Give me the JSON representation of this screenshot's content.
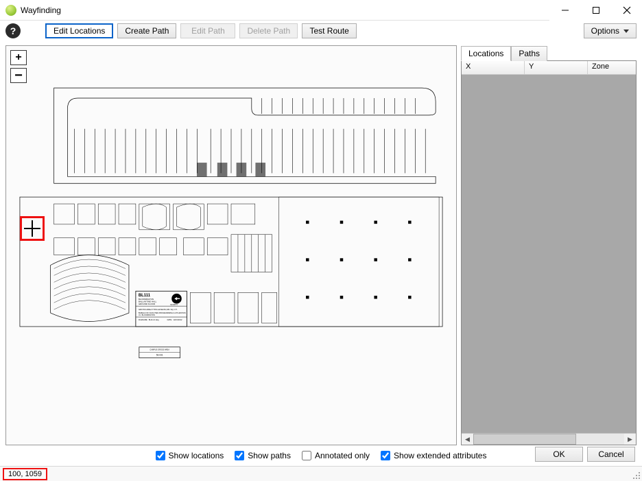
{
  "window": {
    "title": "Wayfinding"
  },
  "toolbar": {
    "help_tooltip": "Help",
    "edit_locations": "Edit Locations",
    "create_path": "Create Path",
    "edit_path": "Edit Path",
    "delete_path": "Delete Path",
    "test_route": "Test Route",
    "options": "Options"
  },
  "zoom": {
    "in": "+",
    "out": "−"
  },
  "tabs": {
    "locations": "Locations",
    "paths": "Paths",
    "active": "locations"
  },
  "grid": {
    "columns": [
      "X",
      "Y",
      "Zone"
    ],
    "rows": []
  },
  "checks": {
    "show_locations": {
      "label": "Show locations",
      "checked": true
    },
    "show_paths": {
      "label": "Show paths",
      "checked": true
    },
    "annotated_only": {
      "label": "Annotated only",
      "checked": false
    },
    "show_extended": {
      "label": "Show extended attributes",
      "checked": true
    }
  },
  "actions": {
    "ok": "OK",
    "cancel": "Cancel"
  },
  "status": {
    "coords": "100, 1059"
  },
  "floorplan": {
    "building_code": "BL111",
    "building_name": "BALLANTINE HALL",
    "campus": "BLOOMINGTON",
    "floor": "GROUND FLOOR",
    "area_label": "GROSS AREA THIS LEVEL:",
    "area_value": "54,031 SQ. FT.",
    "north_label": "NORTH",
    "bureau": "BUREAU OF FACILITIES PROGRAMMING & UTILIZATION",
    "iu": "I.U. BLOOMINGTON",
    "filename_label": "FILENAME",
    "filename_value": "BL111-0.dwg",
    "date_label": "DATE:",
    "date_value": "12/21/2012",
    "campus_gross_label": "CAMPUS GROSS AREA",
    "campus_gross_value": "54,031"
  }
}
